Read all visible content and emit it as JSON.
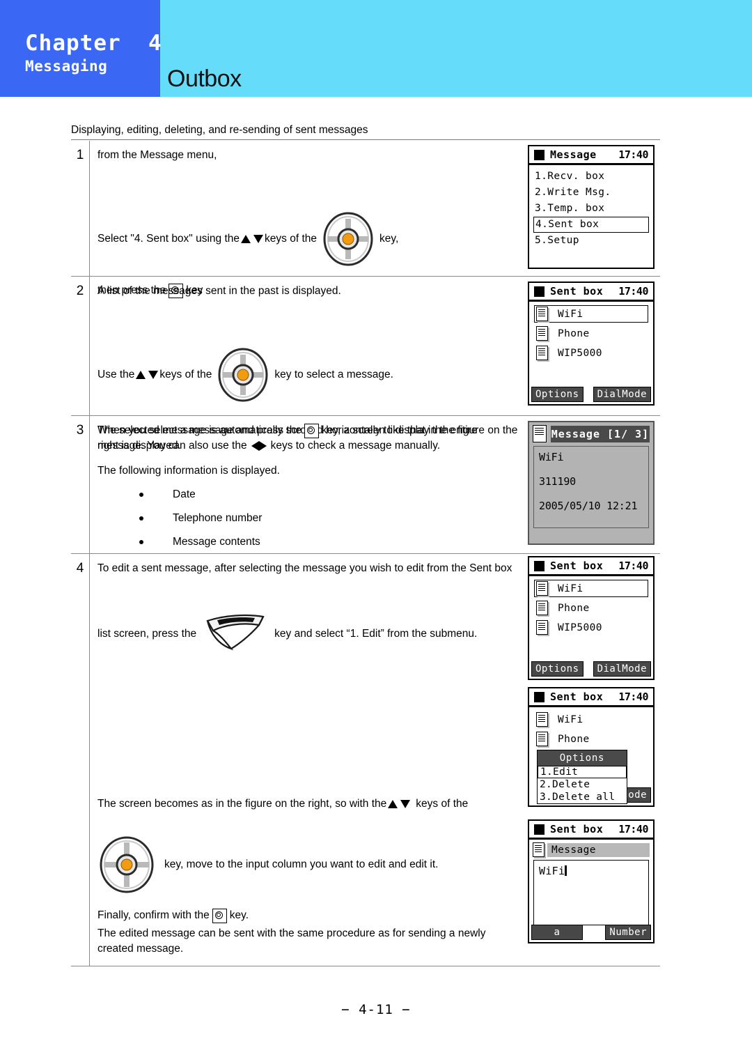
{
  "header": {
    "chapter_label": "Chapter  4",
    "chapter_sub": "Messaging",
    "page_heading": "Outbox",
    "chapter_block_color": "#3a68f5",
    "banner_color": "#66dcfb"
  },
  "intro": "Displaying, editing, deleting, and re-sending of sent messages",
  "steps": {
    "one": {
      "number": "1",
      "line1": "from the Message menu,",
      "line2_a": "Select \"4. Sent box\" using the",
      "line2_b": "keys of the",
      "line2_c": "key,",
      "line3_a": "then press the",
      "line3_b": "key"
    },
    "two": {
      "number": "2",
      "line1": "A list of the messages sent in the past is displayed.",
      "line2_a": "Use the",
      "line2_b": "keys of the",
      "line2_c": "key to select a message.",
      "line3_a": "The selected message is automatically scrolled horizontally to display the entire",
      "line3_b": "message. You can also use the",
      "line3_c": "keys to check a message manually."
    },
    "three": {
      "number": "3",
      "line1_a": "When you select a message and press the",
      "line1_b": "key, a screen like that in the figure on the",
      "line2": "right is displayed.",
      "line3": "The following information is displayed.",
      "bullets": [
        "Date",
        "Telephone number",
        "Message contents"
      ]
    },
    "four": {
      "number": "4",
      "line1": "To edit a sent message, after selecting the message you wish to edit from the Sent box",
      "line2_a": "list screen, press the",
      "line2_b": "key and select “1. Edit” from the submenu.",
      "line3_a": "The screen becomes as in the figure on the right, so with the",
      "line3_b": "keys of the",
      "line4": "key, move to the input column you want to edit and edit it.",
      "line5_a": "Finally, confirm with the",
      "line5_b": "key.",
      "line6_a": "The edited message can be sent with the same procedure as for sending a newly",
      "line6_b": "created message."
    }
  },
  "screens": {
    "message_menu": {
      "title": "Message",
      "time": "17:40",
      "items": [
        "1.Recv. box",
        "2.Write Msg.",
        "3.Temp. box",
        "4.Sent box",
        "5.Setup"
      ],
      "selected_index": 3
    },
    "sent_box_list": {
      "title": "Sent box",
      "time": "17:40",
      "items": [
        "WiFi",
        "Phone",
        "WIP5000"
      ],
      "selected_index": 0,
      "softkey_left": "Options",
      "softkey_right": "DialMode"
    },
    "message_detail": {
      "title": "Message [1/ 3]",
      "lines": [
        "WiFi",
        "311190",
        "2005/05/10 12:21"
      ]
    },
    "sent_box_list_2": {
      "title": "Sent box",
      "time": "17:40",
      "items": [
        "WiFi",
        "Phone",
        "WIP5000"
      ],
      "selected_index": 0,
      "softkey_left": "Options",
      "softkey_right": "DialMode"
    },
    "options_menu": {
      "title": "Sent box",
      "time": "17:40",
      "items": [
        "WiFi",
        "Phone"
      ],
      "popup_title": "Options",
      "popup_items": [
        "1.Edit",
        "2.Delete",
        "3.Delete all"
      ],
      "popup_selected_index": 0,
      "softkey_right": "alMode"
    },
    "message_edit": {
      "title": "Sent box",
      "time": "17:40",
      "field_label": "Message",
      "field_value": "WiFi",
      "softkey_left": "a",
      "softkey_right": "Number"
    }
  },
  "footer": {
    "page_number": "− 4-11 −"
  }
}
